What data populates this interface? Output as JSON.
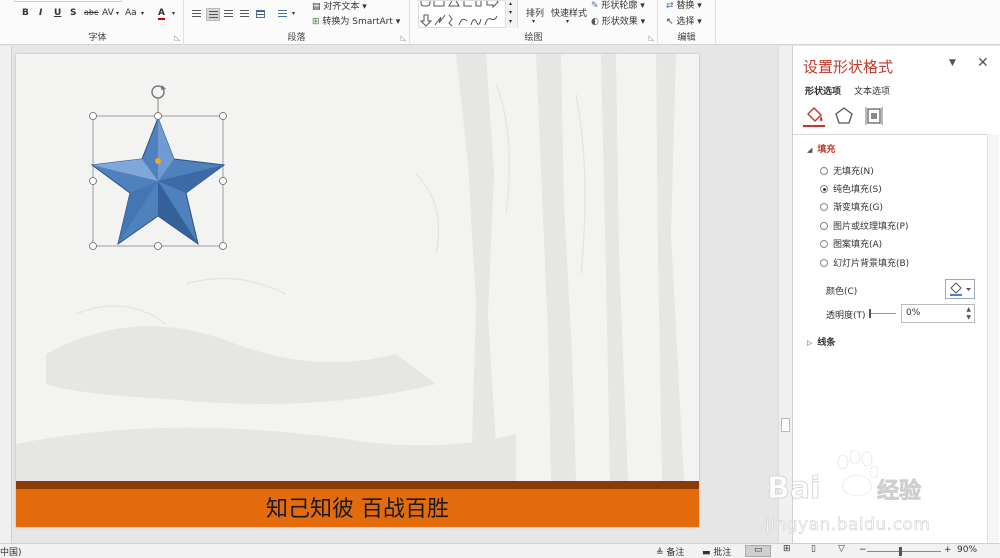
{
  "ribbon": {
    "font_group": {
      "label": "字体",
      "buttons": [
        "B",
        "I",
        "U",
        "S",
        "abc",
        "AV",
        "Aa",
        "A"
      ]
    },
    "paragraph_group": {
      "label": "段落",
      "align_text": "对齐文本",
      "convert_smartart": "转换为 SmartArt"
    },
    "drawing_group": {
      "label": "绘图",
      "arrange": "排列",
      "quick_styles": "快速样式",
      "shape_outline": "形状轮廓",
      "shape_effects": "形状效果"
    },
    "editing_group": {
      "label": "编辑",
      "replace": "替换",
      "select": "选择"
    }
  },
  "slide": {
    "footer_text": "知己知彼 百战百胜",
    "colors": {
      "bar_dark": "#8b3b05",
      "bar_main": "#e36b0b",
      "star_fill": "#4f81bd"
    }
  },
  "format_pane": {
    "title": "设置形状格式",
    "tabs": [
      "形状选项",
      "文本选项"
    ],
    "fill_section": "填充",
    "fill_options": [
      {
        "label": "无填充(N)",
        "selected": false
      },
      {
        "label": "纯色填充(S)",
        "selected": true
      },
      {
        "label": "渐变填充(G)",
        "selected": false
      },
      {
        "label": "图片或纹理填充(P)",
        "selected": false
      },
      {
        "label": "图案填充(A)",
        "selected": false
      },
      {
        "label": "幻灯片背景填充(B)",
        "selected": false
      }
    ],
    "color_label": "颜色(C)",
    "transparency_label": "透明度(T)",
    "transparency_value": "0%",
    "line_section": "线条"
  },
  "status_bar": {
    "language": "中国)",
    "notes": "备注",
    "comments": "批注",
    "zoom": "90%"
  },
  "watermark": {
    "brand": "Baidu经验",
    "url": "jingyan.baidu.com"
  }
}
